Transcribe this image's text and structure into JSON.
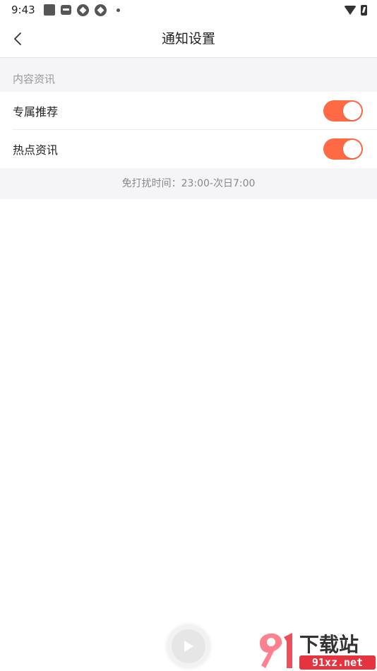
{
  "status_bar": {
    "time": "9:43",
    "icons": [
      "notification-square-icon",
      "news-app-icon",
      "aperture-icon",
      "aperture-icon",
      "more-dot-icon"
    ],
    "right_icons": [
      "wifi-icon",
      "battery-charging-icon"
    ]
  },
  "nav": {
    "back_icon": "chevron-left-icon",
    "title": "通知设置"
  },
  "section": {
    "header": "内容资讯",
    "items": [
      {
        "label": "专属推荐",
        "enabled": true
      },
      {
        "label": "热点资讯",
        "enabled": true
      }
    ],
    "footer_note": "免打扰时间：23:00-次日7:00"
  },
  "fab": {
    "icon": "play-icon"
  },
  "watermark": {
    "text_top": "下载站",
    "text_bottom": "91xz.net",
    "logo_text": "91"
  },
  "colors": {
    "accent": "#ff6a44",
    "background_grey": "#f5f5f7"
  }
}
